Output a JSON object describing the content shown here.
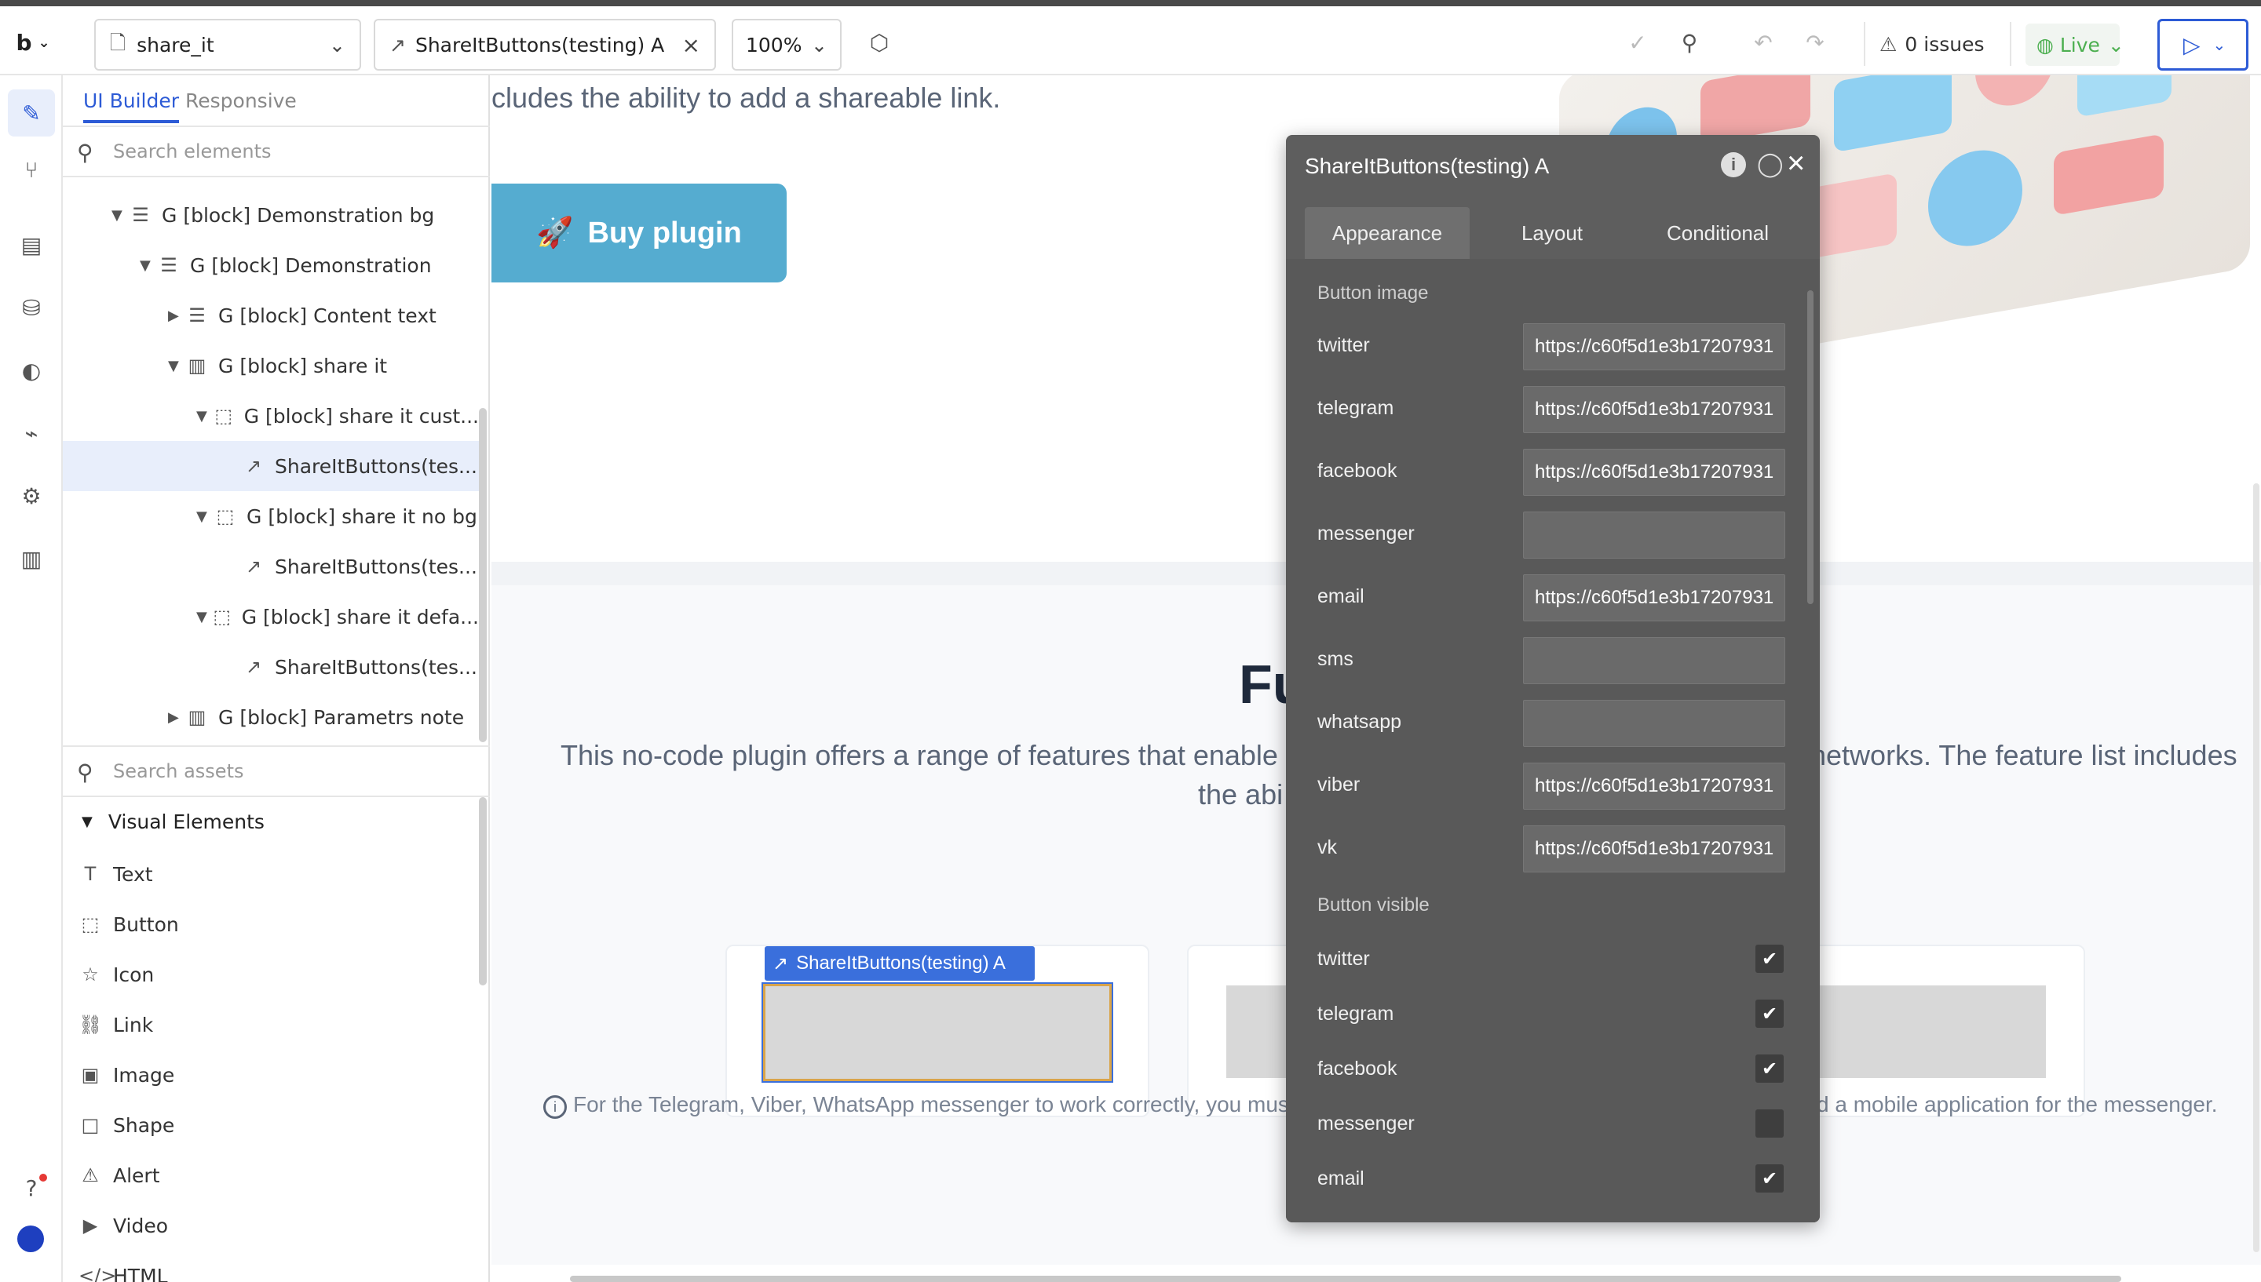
{
  "topbar": {
    "logo": "b",
    "page_name": "share_it",
    "element_name": "ShareItButtons(testing) A",
    "zoom": "100%",
    "issues": "0 issues",
    "mode": "Live"
  },
  "panel": {
    "tab_ui_builder": "UI Builder",
    "tab_responsive": "Responsive",
    "search_elements_placeholder": "Search elements",
    "tree": [
      {
        "label": "G [block] Demonstration bg"
      },
      {
        "label": "G [block] Demonstration"
      },
      {
        "label": "G [block] Content text"
      },
      {
        "label": "G [block] share it"
      },
      {
        "label": "G [block] share it cust..."
      },
      {
        "label": "ShareItButtons(tes..."
      },
      {
        "label": "G [block] share it no bg"
      },
      {
        "label": "ShareItButtons(tes..."
      },
      {
        "label": "G [block] share it defa..."
      },
      {
        "label": "ShareItButtons(tes..."
      },
      {
        "label": "G [block] Parametrs note"
      }
    ],
    "search_assets_placeholder": "Search assets",
    "visual_elements_label": "Visual Elements",
    "visual_elements": [
      {
        "label": "Text"
      },
      {
        "label": "Button"
      },
      {
        "label": "Icon"
      },
      {
        "label": "Link"
      },
      {
        "label": "Image"
      },
      {
        "label": "Shape"
      },
      {
        "label": "Alert"
      },
      {
        "label": "Video"
      },
      {
        "label": "HTML"
      }
    ]
  },
  "canvas": {
    "top_text": "cludes the ability to add a shareable link.",
    "buy_button": "Buy plugin",
    "section_heading": "Fu",
    "section_text_line1": "This no-code plugin offers a range of features that enable us",
    "section_text_line1_right": "networks. The feature list includes",
    "section_text_line2": "the abi",
    "selected_tag": "ShareItButtons(testing) A",
    "note_left": "For the Telegram, Viber, WhatsApp messenger to work correctly, you must",
    "note_right": "d a mobile application for the messenger."
  },
  "property_editor": {
    "title": "ShareItButtons(testing) A",
    "tabs": [
      "Appearance",
      "Layout",
      "Conditional"
    ],
    "button_image_label": "Button image",
    "image_fields": [
      {
        "label": "twitter",
        "value": "https://c60f5d1e3b17207931"
      },
      {
        "label": "telegram",
        "value": "https://c60f5d1e3b17207931"
      },
      {
        "label": "facebook",
        "value": "https://c60f5d1e3b17207931"
      },
      {
        "label": "messenger",
        "value": ""
      },
      {
        "label": "email",
        "value": "https://c60f5d1e3b17207931"
      },
      {
        "label": "sms",
        "value": ""
      },
      {
        "label": "whatsapp",
        "value": ""
      },
      {
        "label": "viber",
        "value": "https://c60f5d1e3b17207931"
      },
      {
        "label": "vk",
        "value": "https://c60f5d1e3b17207931"
      }
    ],
    "button_visible_label": "Button visible",
    "visible_fields": [
      {
        "label": "twitter",
        "checked": true
      },
      {
        "label": "telegram",
        "checked": true
      },
      {
        "label": "facebook",
        "checked": true
      },
      {
        "label": "messenger",
        "checked": false
      },
      {
        "label": "email",
        "checked": true
      }
    ]
  },
  "colors": {
    "accent": "#2d5bd6",
    "buy_button": "#55acd0",
    "property_bg": "#5e5e5e",
    "selection": "#3a6fdc"
  }
}
